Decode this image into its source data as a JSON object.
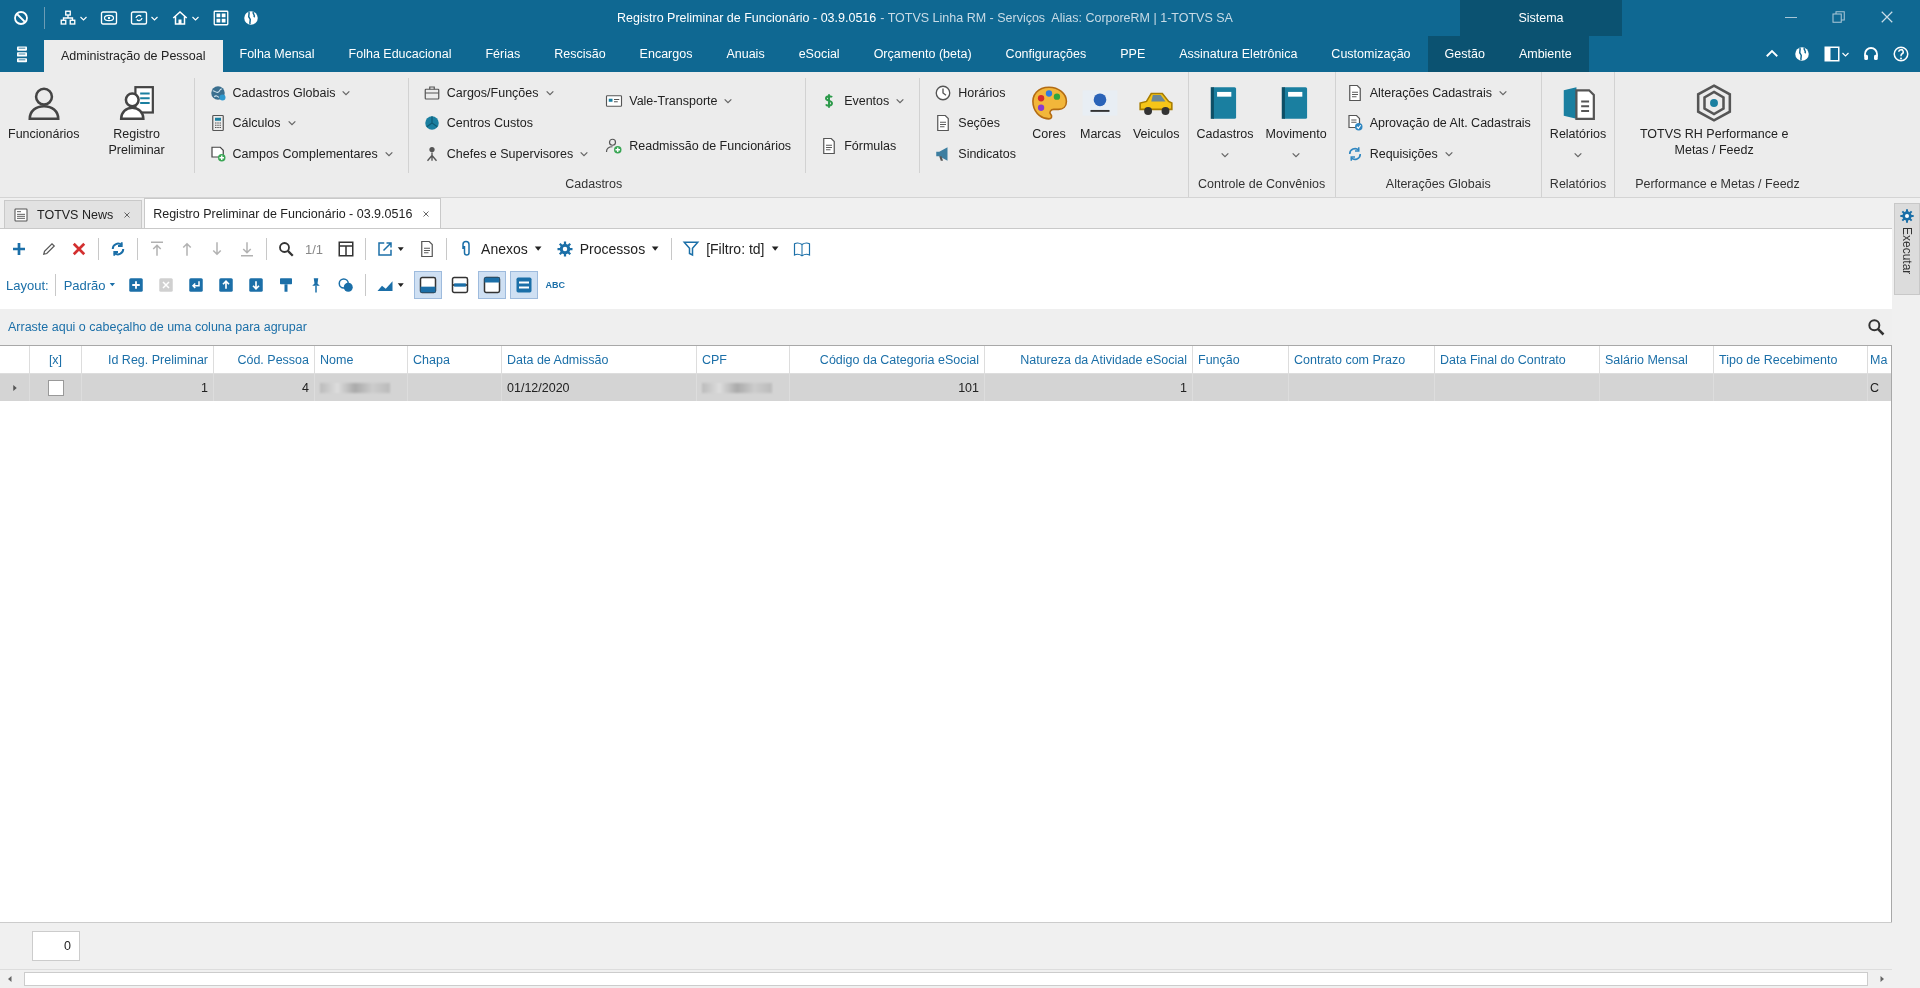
{
  "title_bar": {
    "title": "Registro Preliminar de Funcionário - 03.9.0516",
    "subtitle": "- TOTVS Linha RM - Serviços  Alias: CorporeRM | 1-TOTVS SA",
    "context_label": "Sistema"
  },
  "quick_access": [
    {
      "dropdown": false
    },
    {
      "dropdown": true
    },
    {
      "dropdown": false
    },
    {
      "dropdown": true
    },
    {
      "dropdown": true
    },
    {
      "dropdown": false
    },
    {
      "dropdown": false
    }
  ],
  "menu_tabs": [
    {
      "label": "Administração de Pessoal",
      "selected": true,
      "context": false
    },
    {
      "label": "Folha Mensal",
      "selected": false,
      "context": false
    },
    {
      "label": "Folha Educacional",
      "selected": false,
      "context": false
    },
    {
      "label": "Férias",
      "selected": false,
      "context": false
    },
    {
      "label": "Rescisão",
      "selected": false,
      "context": false
    },
    {
      "label": "Encargos",
      "selected": false,
      "context": false
    },
    {
      "label": "Anuais",
      "selected": false,
      "context": false
    },
    {
      "label": "eSocial",
      "selected": false,
      "context": false
    },
    {
      "label": "Orçamento (beta)",
      "selected": false,
      "context": false
    },
    {
      "label": "Configurações",
      "selected": false,
      "context": false
    },
    {
      "label": "PPE",
      "selected": false,
      "context": false
    },
    {
      "label": "Assinatura Eletrônica",
      "selected": false,
      "context": false
    },
    {
      "label": "Customização",
      "selected": false,
      "context": false
    },
    {
      "label": "Gestão",
      "selected": false,
      "context": true
    },
    {
      "label": "Ambiente",
      "selected": false,
      "context": true
    }
  ],
  "ribbon": {
    "groups": [
      {
        "label": "Cadastros",
        "items": [
          {
            "kind": "large",
            "label": "Funcionários",
            "dropdown": false
          },
          {
            "kind": "large",
            "label": "Registro Preliminar",
            "dropdown": false
          },
          {
            "kind": "separator"
          },
          {
            "kind": "stack",
            "items": [
              {
                "label": "Cadastros Globais",
                "dropdown": true
              },
              {
                "label": "Cálculos",
                "dropdown": true
              },
              {
                "label": "Campos Complementares",
                "dropdown": true
              }
            ]
          },
          {
            "kind": "separator"
          },
          {
            "kind": "stack",
            "items": [
              {
                "label": "Cargos/Funções",
                "dropdown": true
              },
              {
                "label": "Centros Custos",
                "dropdown": false
              },
              {
                "label": "Chefes e Supervisores",
                "dropdown": true
              }
            ]
          },
          {
            "kind": "stack",
            "items": [
              {
                "label": "Vale-Transporte",
                "dropdown": true
              },
              {
                "label": "Readmissão de Funcionários",
                "dropdown": false
              }
            ]
          },
          {
            "kind": "separator"
          },
          {
            "kind": "stack",
            "items": [
              {
                "label": "Eventos",
                "dropdown": true
              },
              {
                "label": "Fórmulas",
                "dropdown": false
              }
            ]
          },
          {
            "kind": "separator"
          },
          {
            "kind": "stack",
            "items": [
              {
                "label": "Horários",
                "dropdown": false
              },
              {
                "label": "Seções",
                "dropdown": false
              },
              {
                "label": "Sindicatos",
                "dropdown": false
              }
            ]
          },
          {
            "kind": "large",
            "label": "Cores",
            "dropdown": false
          },
          {
            "kind": "large",
            "label": "Marcas",
            "dropdown": false
          },
          {
            "kind": "large",
            "label": "Veiculos",
            "dropdown": false
          }
        ]
      },
      {
        "label": "Controle de Convênios",
        "items": [
          {
            "kind": "large",
            "label": "Cadastros",
            "dropdown": true
          },
          {
            "kind": "large",
            "label": "Movimento",
            "dropdown": true
          }
        ]
      },
      {
        "label": "Alterações Globais",
        "items": [
          {
            "kind": "stack",
            "items": [
              {
                "label": "Alterações Cadastrais",
                "dropdown": true
              },
              {
                "label": "Aprovação de Alt. Cadastrais",
                "dropdown": false
              },
              {
                "label": "Requisições",
                "dropdown": true
              }
            ]
          }
        ]
      },
      {
        "label": "Relatórios",
        "items": [
          {
            "kind": "large",
            "label": "Relatórios",
            "dropdown": true
          }
        ]
      },
      {
        "label": "Performance e Metas / Feedz",
        "items": [
          {
            "kind": "large",
            "label": "TOTVS RH Performance e Metas / Feedz",
            "dropdown": false
          }
        ]
      }
    ]
  },
  "doc_tabs": [
    {
      "label": "TOTVS News",
      "selected": false
    },
    {
      "label": "Registro Preliminar de Funcionário - 03.9.0516",
      "selected": true
    }
  ],
  "toolbar": {
    "row1": [
      {
        "kind": "button",
        "disabled": false
      },
      {
        "kind": "button",
        "disabled": false
      },
      {
        "kind": "button",
        "disabled": false
      },
      {
        "kind": "separator"
      },
      {
        "kind": "button",
        "disabled": false
      },
      {
        "kind": "separator"
      },
      {
        "kind": "button",
        "disabled": true
      },
      {
        "kind": "button",
        "disabled": true
      },
      {
        "kind": "button",
        "disabled": true
      },
      {
        "kind": "button",
        "disabled": true
      },
      {
        "kind": "separator"
      },
      {
        "kind": "button",
        "disabled": false
      },
      {
        "kind": "text",
        "text": "1/1"
      },
      {
        "kind": "button",
        "disabled": false
      },
      {
        "kind": "separator"
      },
      {
        "kind": "split"
      },
      {
        "kind": "button",
        "disabled": false
      },
      {
        "kind": "separator"
      },
      {
        "kind": "menu",
        "label": "Anexos"
      },
      {
        "kind": "menu",
        "label": "Processos"
      },
      {
        "kind": "separator"
      },
      {
        "kind": "menu",
        "label": "[Filtro: td]"
      },
      {
        "kind": "button",
        "disabled": false
      }
    ],
    "layout_label": "Layout:",
    "layout_value": "Padrão",
    "row2": [
      {
        "kind": "button",
        "disabled": false
      },
      {
        "kind": "button",
        "disabled": true
      },
      {
        "kind": "button",
        "disabled": false
      },
      {
        "kind": "button",
        "disabled": false
      },
      {
        "kind": "button",
        "disabled": false
      },
      {
        "kind": "button",
        "disabled": false
      },
      {
        "kind": "button",
        "disabled": false
      },
      {
        "kind": "button",
        "disabled": false
      },
      {
        "kind": "separator"
      },
      {
        "kind": "split"
      },
      {
        "kind": "toggle",
        "selected": true
      },
      {
        "kind": "toggle",
        "selected": false
      },
      {
        "kind": "toggle",
        "selected": true
      },
      {
        "kind": "toggle",
        "selected": true
      },
      {
        "kind": "label",
        "label": "ABC"
      }
    ]
  },
  "group_panel": {
    "hint": "Arraste aqui o cabeçalho de uma coluna para agrupar"
  },
  "grid": {
    "columns": [
      {
        "label": "[x]"
      },
      {
        "label": "Id Reg. Preliminar"
      },
      {
        "label": "Cód. Pessoa"
      },
      {
        "label": "Nome"
      },
      {
        "label": "Chapa"
      },
      {
        "label": "Data de Admissão"
      },
      {
        "label": "CPF"
      },
      {
        "label": "Código da Categoria eSocial"
      },
      {
        "label": "Natureza da Atividade eSocial"
      },
      {
        "label": "Função"
      },
      {
        "label": "Contrato com Prazo"
      },
      {
        "label": "Data Final do Contrato"
      },
      {
        "label": "Salário Mensal"
      },
      {
        "label": "Tipo de Recebimento"
      },
      {
        "label": "Ma"
      }
    ],
    "rows": [
      {
        "selected": true,
        "cells": [
          {
            "kind": "checkbox",
            "checked": false
          },
          {
            "kind": "text",
            "text": "1"
          },
          {
            "kind": "text",
            "text": "4"
          },
          {
            "kind": "redacted"
          },
          {
            "kind": "blank"
          },
          {
            "kind": "text",
            "text": "01/12/2020"
          },
          {
            "kind": "redacted"
          },
          {
            "kind": "text",
            "text": "101"
          },
          {
            "kind": "text",
            "text": "1"
          },
          {
            "kind": "blank"
          },
          {
            "kind": "blank"
          },
          {
            "kind": "blank"
          },
          {
            "kind": "blank"
          },
          {
            "kind": "blank"
          },
          {
            "kind": "text",
            "text": "C"
          }
        ]
      }
    ]
  },
  "footer": {
    "count": "0"
  },
  "side_panel": {
    "label": "Executar"
  }
}
